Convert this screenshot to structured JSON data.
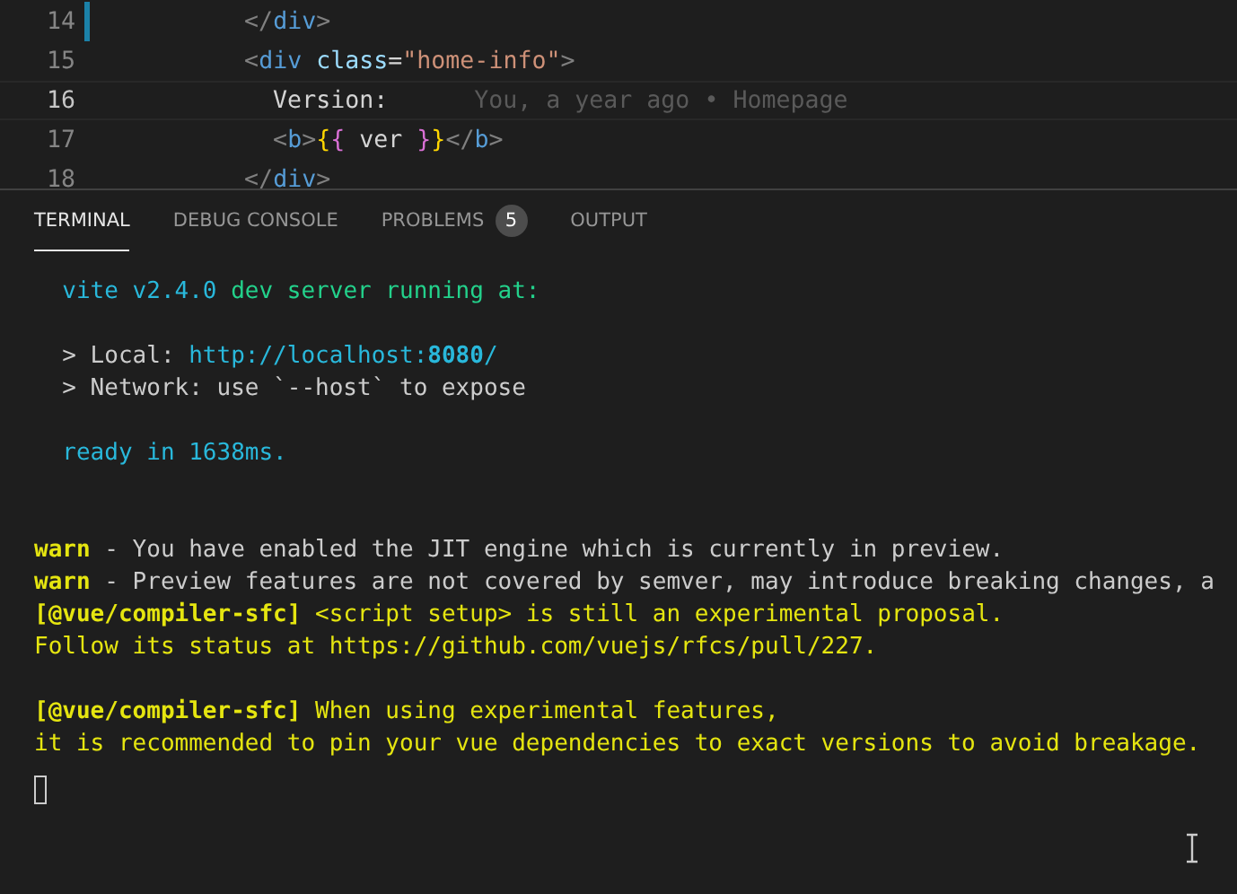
{
  "editor": {
    "lines": [
      {
        "number": "14",
        "current": false,
        "modified": true,
        "tokens": [
          {
            "kind": "punct",
            "text": "        </"
          },
          {
            "kind": "tag",
            "text": "div"
          },
          {
            "kind": "punct",
            "text": ">"
          }
        ]
      },
      {
        "number": "15",
        "current": false,
        "modified": false,
        "tokens": [
          {
            "kind": "punct",
            "text": "        <"
          },
          {
            "kind": "tag",
            "text": "div"
          },
          {
            "kind": "attr",
            "text": " class"
          },
          {
            "kind": "text",
            "text": "="
          },
          {
            "kind": "string",
            "text": "\"home-info\""
          },
          {
            "kind": "punct",
            "text": ">"
          }
        ]
      },
      {
        "number": "16",
        "current": true,
        "modified": false,
        "blame": "You, a year ago • Homepage",
        "tokens": [
          {
            "kind": "text",
            "text": "          Version:"
          }
        ]
      },
      {
        "number": "17",
        "current": false,
        "modified": false,
        "tokens": [
          {
            "kind": "punct",
            "text": "          <"
          },
          {
            "kind": "tag",
            "text": "b"
          },
          {
            "kind": "punct",
            "text": ">"
          },
          {
            "kind": "brace1",
            "text": "{"
          },
          {
            "kind": "brace2",
            "text": "{"
          },
          {
            "kind": "text",
            "text": " ver "
          },
          {
            "kind": "brace2",
            "text": "}"
          },
          {
            "kind": "brace1",
            "text": "}"
          },
          {
            "kind": "punct",
            "text": "</"
          },
          {
            "kind": "tag",
            "text": "b"
          },
          {
            "kind": "punct",
            "text": ">"
          }
        ]
      },
      {
        "number": "18",
        "current": false,
        "modified": false,
        "tokens": [
          {
            "kind": "punct",
            "text": "        </"
          },
          {
            "kind": "tag",
            "text": "div"
          },
          {
            "kind": "punct",
            "text": ">"
          }
        ]
      }
    ]
  },
  "panel": {
    "tabs": [
      {
        "label": "TERMINAL",
        "selected": true
      },
      {
        "label": "DEBUG CONSOLE",
        "selected": false
      },
      {
        "label": "PROBLEMS",
        "selected": false,
        "badge": "5"
      },
      {
        "label": "OUTPUT",
        "selected": false
      }
    ]
  },
  "terminal": {
    "sections": [
      {
        "blocks": [
          {
            "lines": [
              {
                "segments": [
                  {
                    "kind": "cyan",
                    "text": "  vite v2.4.0"
                  },
                  {
                    "kind": "green",
                    "text": " dev server running at:"
                  }
                ]
              }
            ]
          },
          {
            "lines": [
              {
                "segments": [
                  {
                    "kind": "plain",
                    "text": "  > Local: "
                  },
                  {
                    "kind": "cyan",
                    "text": "http://localhost:"
                  },
                  {
                    "kind": "cyan-bold",
                    "text": "8080"
                  },
                  {
                    "kind": "cyan",
                    "text": "/"
                  }
                ]
              },
              {
                "segments": [
                  {
                    "kind": "plain",
                    "text": "  > Network: use `--host` to expose"
                  }
                ]
              }
            ]
          },
          {
            "lines": [
              {
                "segments": [
                  {
                    "kind": "cyan",
                    "text": "  ready in 1638ms."
                  }
                ]
              }
            ]
          }
        ]
      },
      {
        "blocks": [
          {
            "lines": [
              {
                "segments": [
                  {
                    "kind": "yellow-bold",
                    "text": "warn"
                  },
                  {
                    "kind": "plain",
                    "text": " - You have enabled the JIT engine which is currently in preview."
                  }
                ]
              },
              {
                "segments": [
                  {
                    "kind": "yellow-bold",
                    "text": "warn"
                  },
                  {
                    "kind": "plain",
                    "text": " - Preview features are not covered by semver, may introduce breaking changes, a"
                  }
                ]
              },
              {
                "segments": [
                  {
                    "kind": "yellow-bold",
                    "text": "[@vue/compiler-sfc]"
                  },
                  {
                    "kind": "yellow",
                    "text": " <script setup> is still an experimental proposal."
                  }
                ]
              },
              {
                "segments": [
                  {
                    "kind": "yellow",
                    "text": "Follow its status at https://github.com/vuejs/rfcs/pull/227."
                  }
                ]
              }
            ]
          },
          {
            "lines": [
              {
                "segments": [
                  {
                    "kind": "yellow-bold",
                    "text": "[@vue/compiler-sfc]"
                  },
                  {
                    "kind": "yellow",
                    "text": " When using experimental features,"
                  }
                ]
              },
              {
                "segments": [
                  {
                    "kind": "yellow",
                    "text": "it is recommended to pin your vue dependencies to exact versions to avoid breakage."
                  }
                ]
              }
            ]
          }
        ]
      }
    ]
  }
}
